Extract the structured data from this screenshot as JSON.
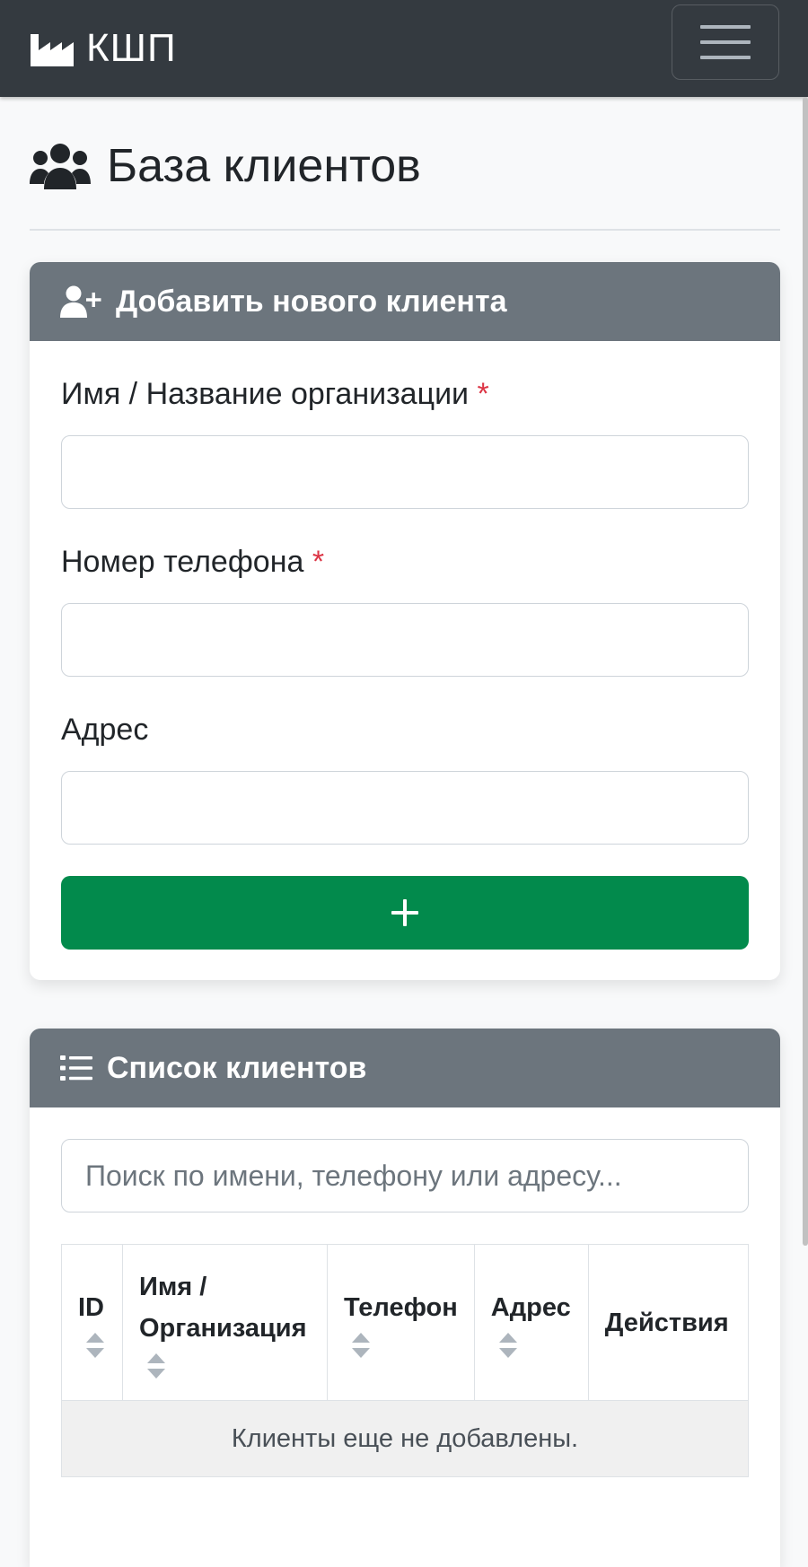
{
  "navbar": {
    "brand_icon": "factory-icon",
    "brand_text": "КШП",
    "toggler_icon": "hamburger-menu-icon"
  },
  "page": {
    "title_icon": "users-icon",
    "title": "База клиентов"
  },
  "add_card": {
    "header_icon": "user-plus-icon",
    "header": "Добавить нового клиента",
    "fields": [
      {
        "label": "Имя / Название организации",
        "required": true,
        "value": "",
        "required_mark": "*"
      },
      {
        "label": "Номер телефона",
        "required": true,
        "value": "",
        "required_mark": "*"
      },
      {
        "label": "Адрес",
        "required": false,
        "value": ""
      }
    ],
    "submit_icon": "plus-icon"
  },
  "list_card": {
    "header_icon": "list-icon",
    "header": "Список клиентов",
    "search_placeholder": "Поиск по имени, телефону или адресу...",
    "search_value": "",
    "table": {
      "columns": [
        {
          "label": "ID",
          "sortable": true
        },
        {
          "label": "Имя / Организация",
          "sortable": true
        },
        {
          "label": "Телефон",
          "sortable": true
        },
        {
          "label": "Адрес",
          "sortable": true
        },
        {
          "label": "Действия",
          "sortable": false
        }
      ],
      "empty_message": "Клиенты еще не добавлены."
    }
  },
  "colors": {
    "navbar": "#343a40",
    "card_header": "#6c757d",
    "add_button": "#028a4c",
    "required": "#dc3545"
  }
}
